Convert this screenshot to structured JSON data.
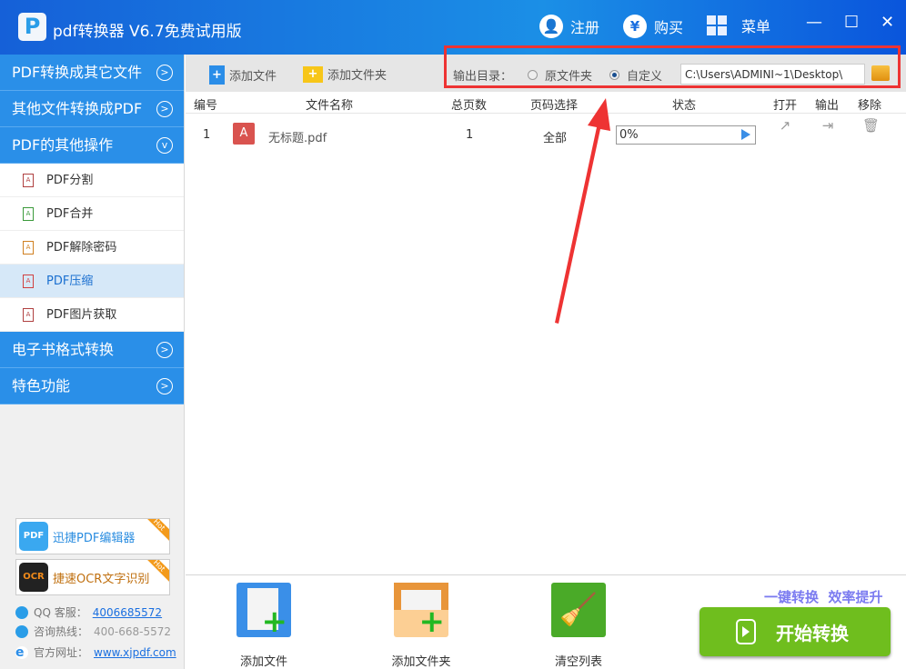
{
  "app": {
    "title": "pdf转换器 V6.7免费试用版",
    "register": "注册",
    "buy": "购买",
    "menu": "菜单"
  },
  "sidebar": {
    "groups": [
      {
        "label": "PDF转换成其它文件"
      },
      {
        "label": "其他文件转换成PDF"
      },
      {
        "label": "PDF的其他操作"
      }
    ],
    "items": [
      {
        "label": "PDF分割"
      },
      {
        "label": "PDF合并"
      },
      {
        "label": "PDF解除密码"
      },
      {
        "label": "PDF压缩"
      },
      {
        "label": "PDF图片获取"
      }
    ],
    "groups2": [
      {
        "label": "电子书格式转换"
      },
      {
        "label": "特色功能"
      }
    ],
    "promos": [
      {
        "label": "迅捷PDF编辑器",
        "badge": "Hot",
        "icon": "PDF"
      },
      {
        "label": "捷速OCR文字识别",
        "badge": "Hot",
        "icon": "OCR"
      }
    ],
    "contact": {
      "qq_label": "QQ 客服：",
      "qq": "4006685572",
      "hotline_label": "咨询热线：",
      "hotline": "400-668-5572",
      "site_label": "官方网址：",
      "site": "www.xjpdf.com"
    }
  },
  "toolbar": {
    "add_file": "添加文件",
    "add_folder": "添加文件夹",
    "output_label": "输出目录：",
    "opt_source": "原文件夹",
    "opt_custom": "自定义",
    "path": "C:\\Users\\ADMINI~1\\Desktop\\"
  },
  "table": {
    "headers": [
      "编号",
      "文件名称",
      "总页数",
      "页码选择",
      "状态",
      "打开",
      "输出",
      "移除"
    ],
    "rows": [
      {
        "no": "1",
        "name": "无标题.pdf",
        "pages": "1",
        "range": "全部",
        "status": "0%"
      }
    ]
  },
  "bottom": {
    "add_file": "添加文件",
    "add_folder": "添加文件夹",
    "clear": "清空列表",
    "slogan": "一键转换  效率提升",
    "start": "开始转换"
  }
}
